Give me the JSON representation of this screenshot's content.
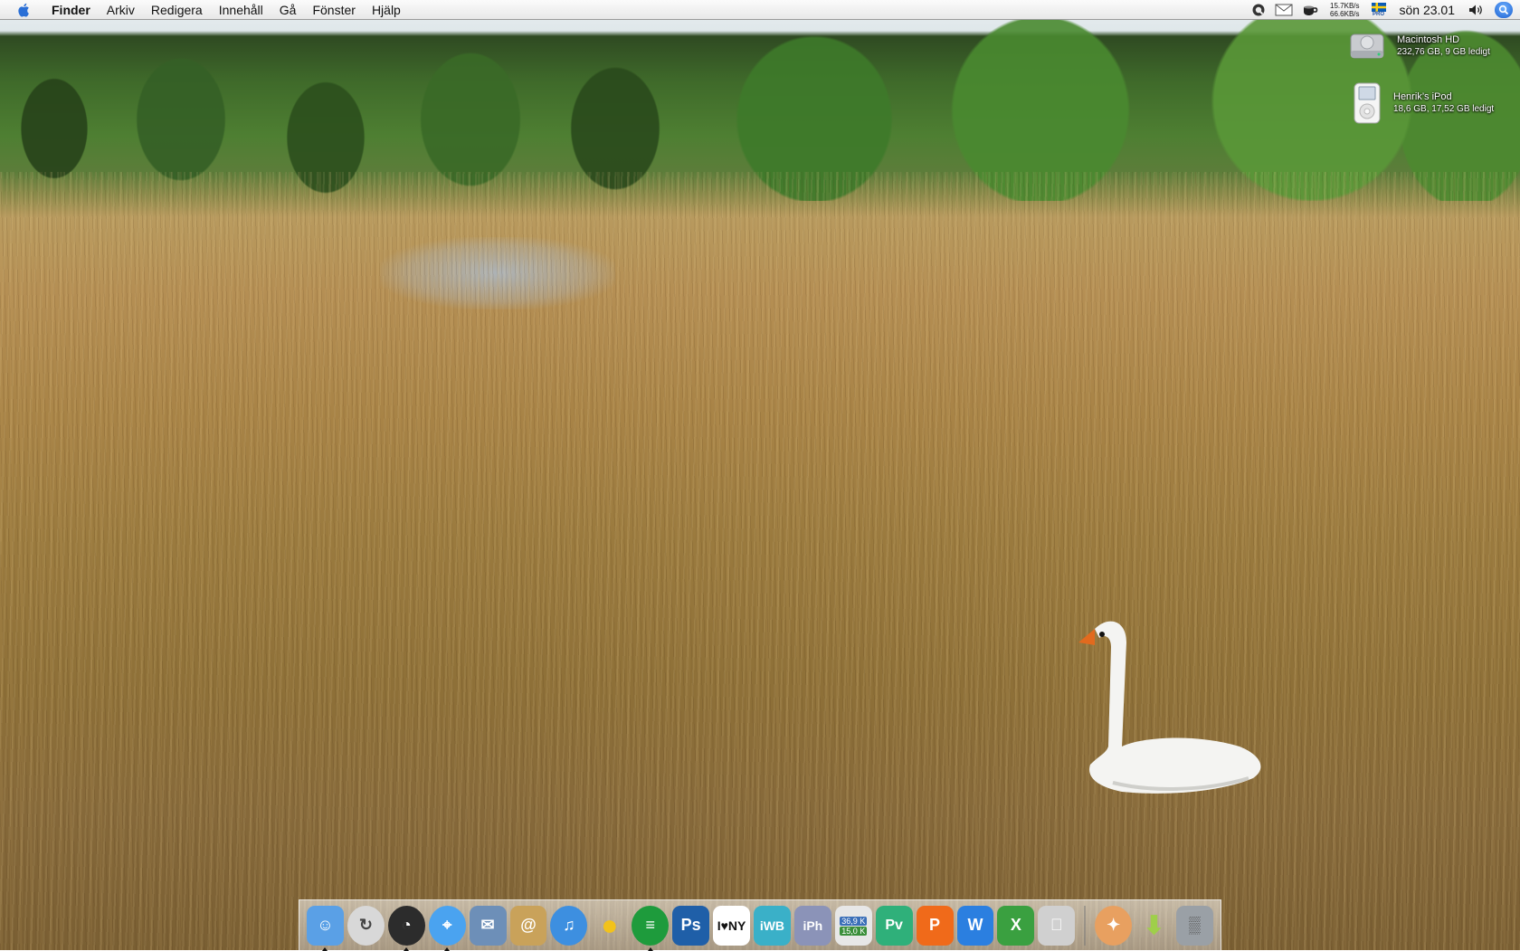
{
  "menubar": {
    "app_name": "Finder",
    "menus": [
      "Arkiv",
      "Redigera",
      "Innehåll",
      "Gå",
      "Fönster",
      "Hjälp"
    ],
    "netstat_up": "15.7KB/s",
    "netstat_down": "66.6KB/s",
    "flag_badge": "PRO",
    "clock": "sön 23.01"
  },
  "desktop_icons": [
    {
      "name": "Macintosh HD",
      "info": "232,76 GB, 9 GB ledigt",
      "icon": "hard-drive-icon"
    },
    {
      "name": "Henrik’s iPod",
      "info": "18,6 GB, 17,52 GB ledigt",
      "icon": "ipod-icon"
    }
  ],
  "dock": {
    "items": [
      {
        "id": "finder",
        "icon": "finder-icon",
        "color": "#5aa0e6",
        "glyph": "☺",
        "running": true
      },
      {
        "id": "sync",
        "icon": "sync-icon",
        "color": "#d8d8d8",
        "glyph": "↻",
        "running": false
      },
      {
        "id": "dashboard",
        "icon": "dashboard-icon",
        "color": "#2c2c2c",
        "glyph": "◔",
        "running": true
      },
      {
        "id": "safari",
        "icon": "safari-icon",
        "color": "#4aa3f0",
        "glyph": "⌖",
        "running": true
      },
      {
        "id": "mail",
        "icon": "mail-bird-icon",
        "color": "#6d8fb8",
        "glyph": "✉",
        "running": false
      },
      {
        "id": "address-book",
        "icon": "address-book-icon",
        "color": "#c9a25a",
        "glyph": "@",
        "running": false
      },
      {
        "id": "itunes",
        "icon": "itunes-icon",
        "color": "#3d8fe0",
        "glyph": "♫",
        "running": false
      },
      {
        "id": "adium",
        "icon": "duck-icon",
        "color": "#f2c21b",
        "glyph": "●",
        "running": false
      },
      {
        "id": "spotify",
        "icon": "spotify-icon",
        "color": "#1e9b3c",
        "glyph": "≡",
        "running": true
      },
      {
        "id": "photoshop",
        "icon": "photoshop-icon",
        "color": "#1f5fa8",
        "glyph": "Ps",
        "running": false
      },
      {
        "id": "i-love-ny",
        "icon": "i-love-ny-icon",
        "color": "#ffffff",
        "glyph": "I♥NY",
        "running": false
      },
      {
        "id": "iweb",
        "icon": "iweb-icon",
        "color": "#3ab0c8",
        "glyph": "iWB",
        "running": false
      },
      {
        "id": "iphoto",
        "icon": "iphoto-icon",
        "color": "#8b93b8",
        "glyph": "iPh",
        "running": false
      },
      {
        "id": "network-monitor",
        "icon": "network-monitor-icon",
        "color": "#e7e7e7",
        "glyph": "",
        "running": false,
        "badge_up": "36,9 K",
        "badge_down": "15,0 K"
      },
      {
        "id": "preview",
        "icon": "preview-icon",
        "color": "#2fb07a",
        "glyph": "Pv",
        "running": false
      },
      {
        "id": "pages",
        "icon": "pages-icon",
        "color": "#f06a1a",
        "glyph": "P",
        "running": false
      },
      {
        "id": "word",
        "icon": "word-icon",
        "color": "#2b7fe0",
        "glyph": "W",
        "running": false
      },
      {
        "id": "excel",
        "icon": "excel-icon",
        "color": "#3aa040",
        "glyph": "X",
        "running": false
      },
      {
        "id": "system-prefs",
        "icon": "apple-prefs-icon",
        "color": "#d0d0d0",
        "glyph": "",
        "running": false
      }
    ],
    "right_items": [
      {
        "id": "stack",
        "icon": "stack-icon",
        "color": "#e8a060",
        "glyph": "✦"
      },
      {
        "id": "downloads",
        "icon": "downloads-icon",
        "color": "#9fcf4a",
        "glyph": "⬇"
      },
      {
        "id": "trash",
        "icon": "trash-icon",
        "color": "#9aa0a6",
        "glyph": "▒"
      }
    ]
  }
}
